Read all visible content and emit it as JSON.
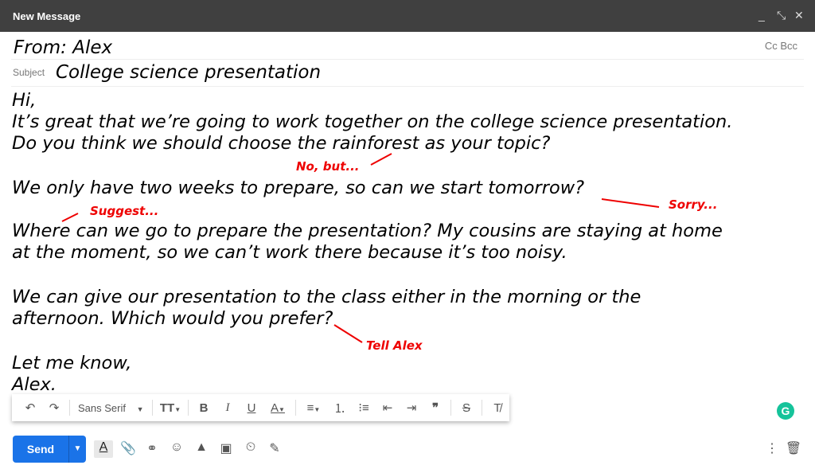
{
  "window": {
    "title": "New Message",
    "controls": [
      "minimize",
      "expand",
      "close"
    ]
  },
  "header": {
    "from": "From: Alex",
    "cc_bcc": "Cc Bcc",
    "subject_label": "Subject",
    "subject": "College science presentation"
  },
  "body": {
    "lines": [
      "Hi,",
      "It’s great that we’re going to work together on the college science presentation.",
      "Do you think we should choose the rainforest as your topic?",
      "We only have two weeks to prepare, so can we start tomorrow?",
      "Where can we go to prepare the presentation? My cousins are staying at home",
      "at the moment, so we can’t work there because it’s too noisy.",
      "We can give our presentation to the class either in the morning or the",
      "afternoon. Which would you prefer?",
      "Let me know,",
      "Alex."
    ]
  },
  "annotations": [
    {
      "text": "No, but..."
    },
    {
      "text": "Sorry..."
    },
    {
      "text": "Suggest..."
    },
    {
      "text": "Tell Alex"
    }
  ],
  "annotation_color": "#e00000",
  "toolbar": {
    "font": "Sans Serif"
  },
  "footer": {
    "send_label": "Send"
  },
  "accent": "#1a73e8"
}
